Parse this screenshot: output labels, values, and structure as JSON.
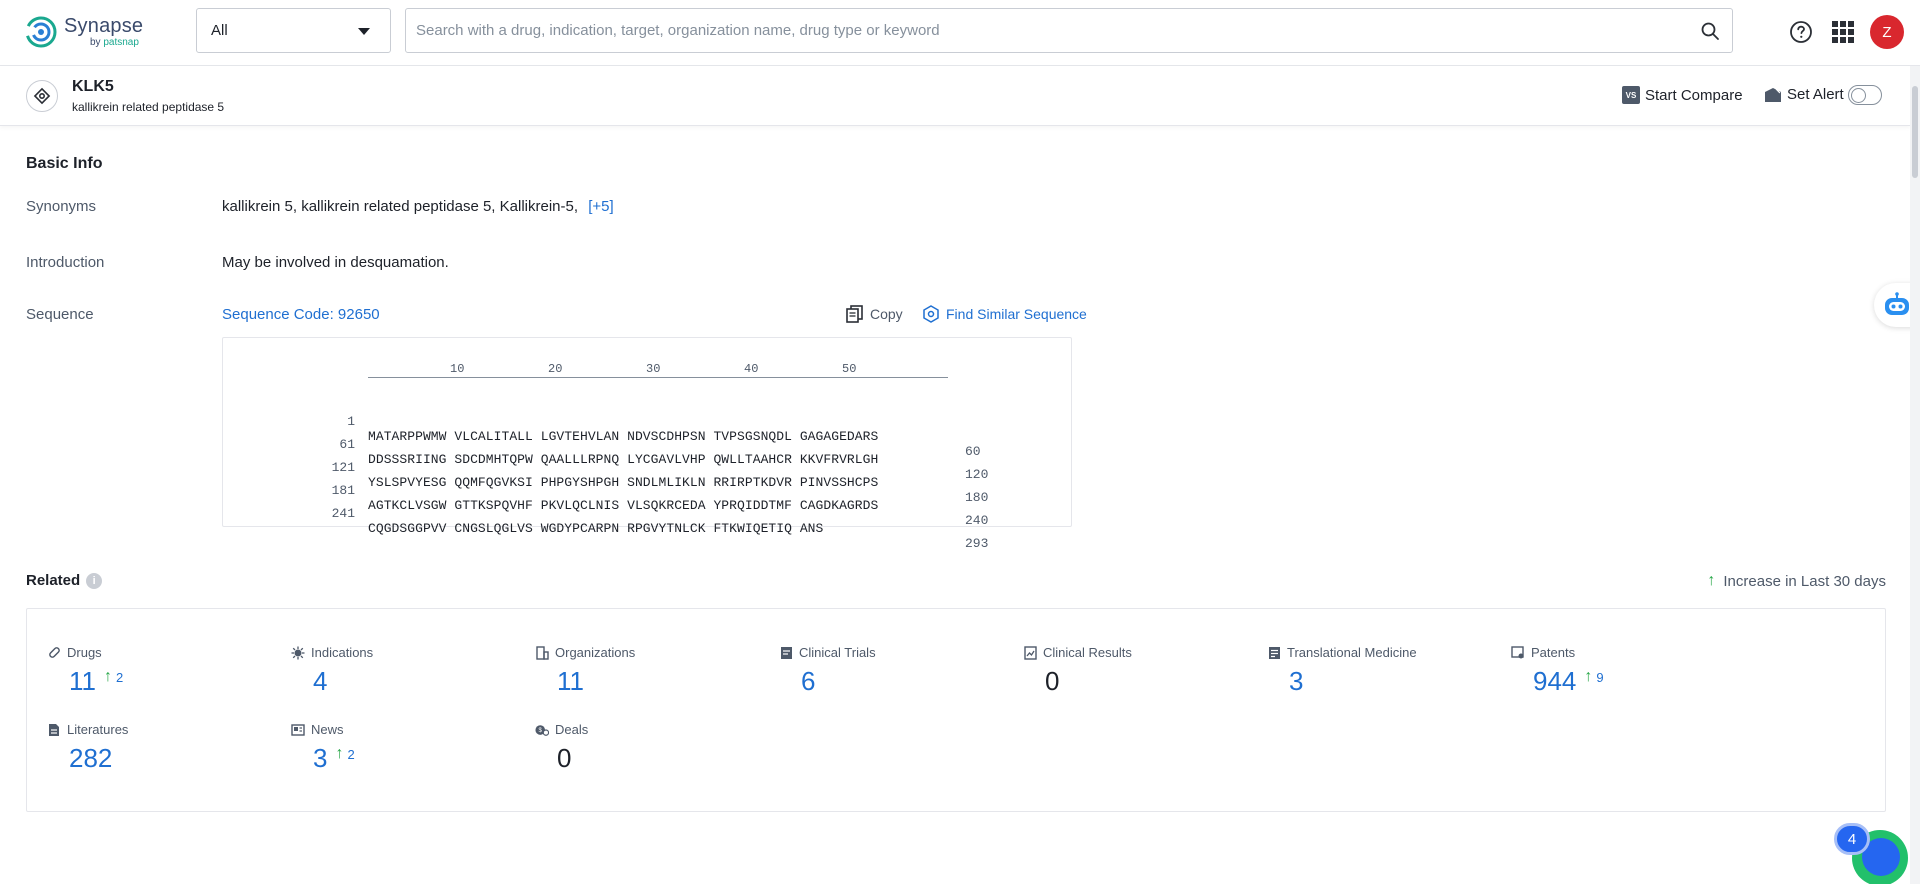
{
  "app": {
    "name": "Synapse",
    "by": "by",
    "brand": "patsnap"
  },
  "search": {
    "scope": "All",
    "placeholder": "Search with a drug, indication, target, organization name, drug type or keyword",
    "value": ""
  },
  "user": {
    "initial": "Z"
  },
  "target": {
    "symbol": "KLK5",
    "full_name": "kallikrein related peptidase 5"
  },
  "actions": {
    "start_compare": "Start Compare",
    "vs_badge": "VS",
    "set_alert": "Set Alert",
    "alert_on": false
  },
  "basic_info": {
    "title": "Basic Info",
    "synonyms_label": "Synonyms",
    "synonyms": "kallikrein 5,  kallikrein related peptidase 5,  Kallikrein-5,",
    "synonyms_more": "[+5]",
    "introduction_label": "Introduction",
    "introduction": "May be involved in desquamation.",
    "sequence_label": "Sequence",
    "sequence_code": "Sequence Code: 92650",
    "copy": "Copy",
    "find_similar": "Find Similar Sequence"
  },
  "sequence": {
    "ruler": [
      "10",
      "20",
      "30",
      "40",
      "50"
    ],
    "rows": [
      {
        "start": "1",
        "residues": "MATARPPWMW VLCALITALL LGVTEHVLAN NDVSCDHPSN TVPSGSNQDL GAGAGEDARS",
        "end": "60"
      },
      {
        "start": "61",
        "residues": "DDSSSRIING SDCDMHTQPW QAALLLRPNQ LYCGAVLVHP QWLLTAAHCR KKVFRVRLGH",
        "end": "120"
      },
      {
        "start": "121",
        "residues": "YSLSPVYESG QQMFQGVKSI PHPGYSHPGH SNDLMLIKLN RRIRPTKDVR PINVSSHCPS",
        "end": "180"
      },
      {
        "start": "181",
        "residues": "AGTKCLVSGW GTTKSPQVHF PKVLQCLNIS VLSQKRCEDA YPRQIDDTMF CAGDKAGRDS",
        "end": "240"
      },
      {
        "start": "241",
        "residues": "CQGDSGGPVV CNGSLQGLVS WGDYPCARPN RPGVYTNLCK FTKWIQETIQ ANS",
        "end": "293"
      }
    ]
  },
  "related": {
    "title": "Related",
    "info": "i",
    "increase_note": "Increase in Last 30 days",
    "items": [
      {
        "label": "Drugs",
        "value": "11",
        "delta": "2"
      },
      {
        "label": "Indications",
        "value": "4",
        "delta": ""
      },
      {
        "label": "Organizations",
        "value": "11",
        "delta": ""
      },
      {
        "label": "Clinical Trials",
        "value": "6",
        "delta": ""
      },
      {
        "label": "Clinical Results",
        "value": "0",
        "delta": ""
      },
      {
        "label": "Translational Medicine",
        "value": "3",
        "delta": ""
      },
      {
        "label": "Patents",
        "value": "944",
        "delta": "9"
      },
      {
        "label": "Literatures",
        "value": "282",
        "delta": ""
      },
      {
        "label": "News",
        "value": "3",
        "delta": "2"
      },
      {
        "label": "Deals",
        "value": "0",
        "delta": ""
      }
    ]
  },
  "fab": {
    "badge": "4"
  },
  "colors": {
    "link": "#1f6fd1",
    "increase": "#2aa84a",
    "avatar": "#d9272e",
    "brand_teal": "#1aa88f"
  }
}
